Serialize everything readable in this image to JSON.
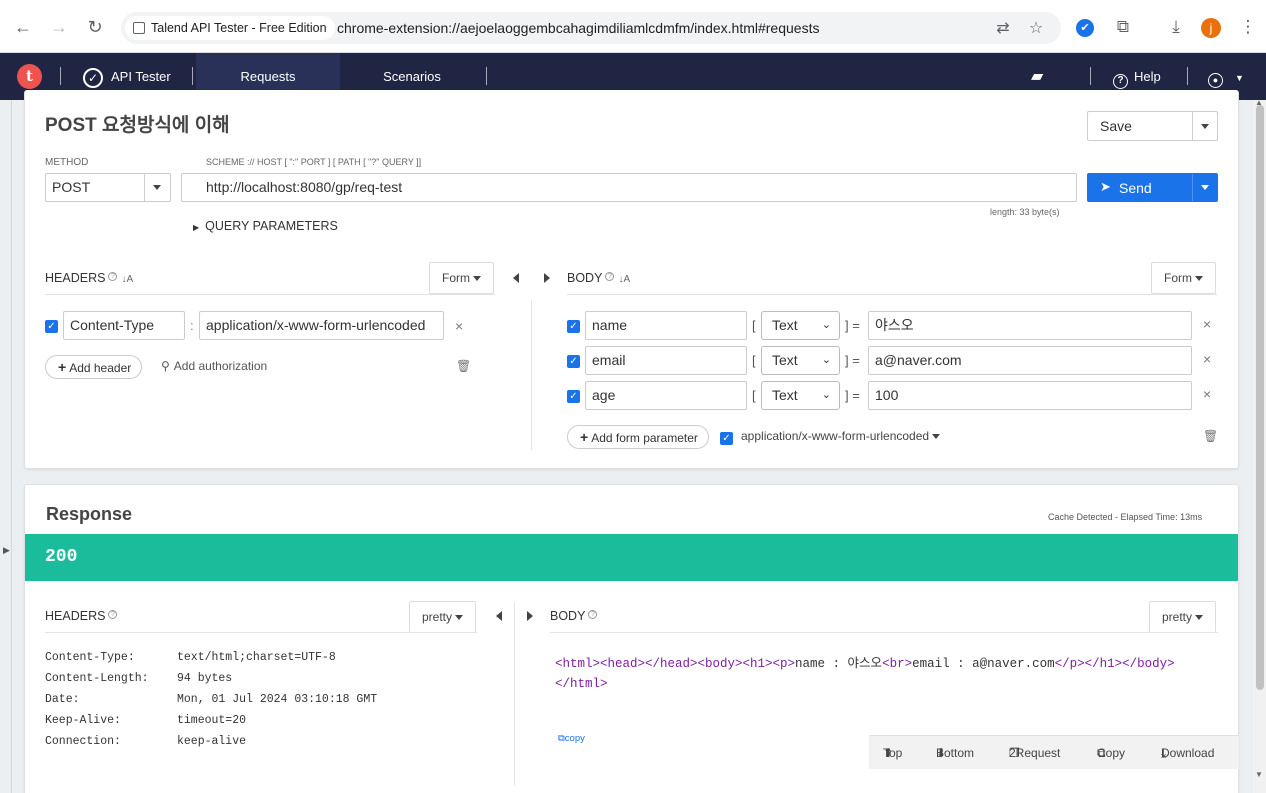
{
  "browser": {
    "extension_name": "Talend API Tester - Free Edition",
    "url": "chrome-extension://aejoelaoggembcahagimdiliamlcdmfm/index.html#requests",
    "profile_initial": "j"
  },
  "appnav": {
    "logo_letter": "t",
    "product": "API Tester",
    "tabs": [
      "Requests",
      "Scenarios"
    ],
    "help": "Help"
  },
  "request": {
    "title": "POST 요청방식에 이해",
    "save_label": "Save",
    "method_label": "METHOD",
    "method": "POST",
    "url_label": "SCHEME :// HOST [ \":\" PORT ] [ PATH [ \"?\" QUERY ]]",
    "url": "http://localhost:8080/gp/req-test",
    "send_label": "Send",
    "length": "length: 33 byte(s)",
    "query_params": "QUERY PARAMETERS",
    "headers_title": "HEADERS",
    "form_label": "Form",
    "header_name": "Content-Type",
    "header_value": "application/x-www-form-urlencoded",
    "add_header": "Add header",
    "add_auth": "Add authorization",
    "body_title": "BODY",
    "body_rows": [
      {
        "name": "name",
        "type": "Text",
        "value": "야스오"
      },
      {
        "name": "email",
        "type": "Text",
        "value": "a@naver.com"
      },
      {
        "name": "age",
        "type": "Text",
        "value": "100"
      }
    ],
    "add_form_param": "Add form parameter",
    "content_type_select": "application/x-www-form-urlencoded"
  },
  "response": {
    "title": "Response",
    "elapsed": "Cache Detected - Elapsed Time: 13ms",
    "status": "200",
    "status_color": "#1abc9c",
    "headers_title": "HEADERS",
    "pretty_label": "pretty",
    "headers": [
      {
        "key": "Content-Type:",
        "value": "text/html;charset=UTF-8"
      },
      {
        "key": "Content-Length:",
        "value": "94 bytes"
      },
      {
        "key": "Date:",
        "value": "Mon, 01 Jul 2024 03:10:18 GMT"
      },
      {
        "key": "Keep-Alive:",
        "value": "timeout=20"
      },
      {
        "key": "Connection:",
        "value": "keep-alive"
      }
    ],
    "body_title": "BODY",
    "body_line1_tags": "<html><head></head><body><h1><p>",
    "body_line1_text1": "name : 야스오",
    "body_line1_br": "<br>",
    "body_line1_text2": "email : a@naver.com",
    "body_line1_close": "</p></h1></body>",
    "body_line2": "</html>",
    "copy_label": "copy",
    "bottom_actions": [
      "Top",
      "Bottom",
      "2Request",
      "Copy",
      "Download"
    ]
  }
}
